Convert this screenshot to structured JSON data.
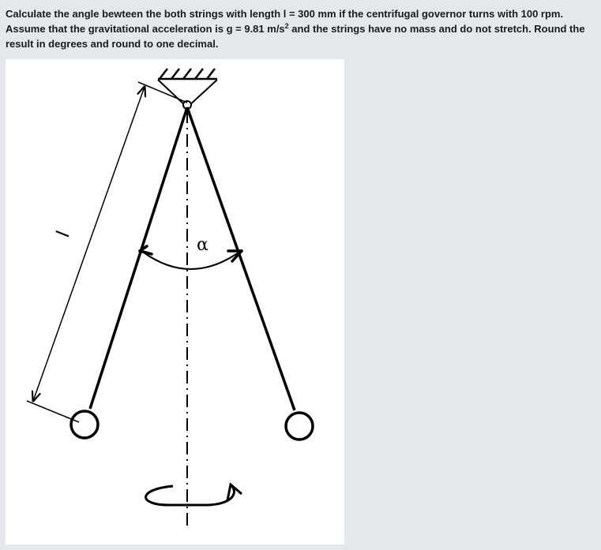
{
  "question": {
    "part1": "Calculate the angle bewteen the both strings with length l = 300 mm if the centrifugal governor turns with 100 rpm. Assume that the gravitational acceleration is g = 9.81 m/s",
    "sup": "2",
    "part2": " and the strings have no mass and do not stretch. Round the result in degrees and round to one decimal."
  },
  "figure": {
    "angle_label": "α",
    "length_label": "l"
  }
}
